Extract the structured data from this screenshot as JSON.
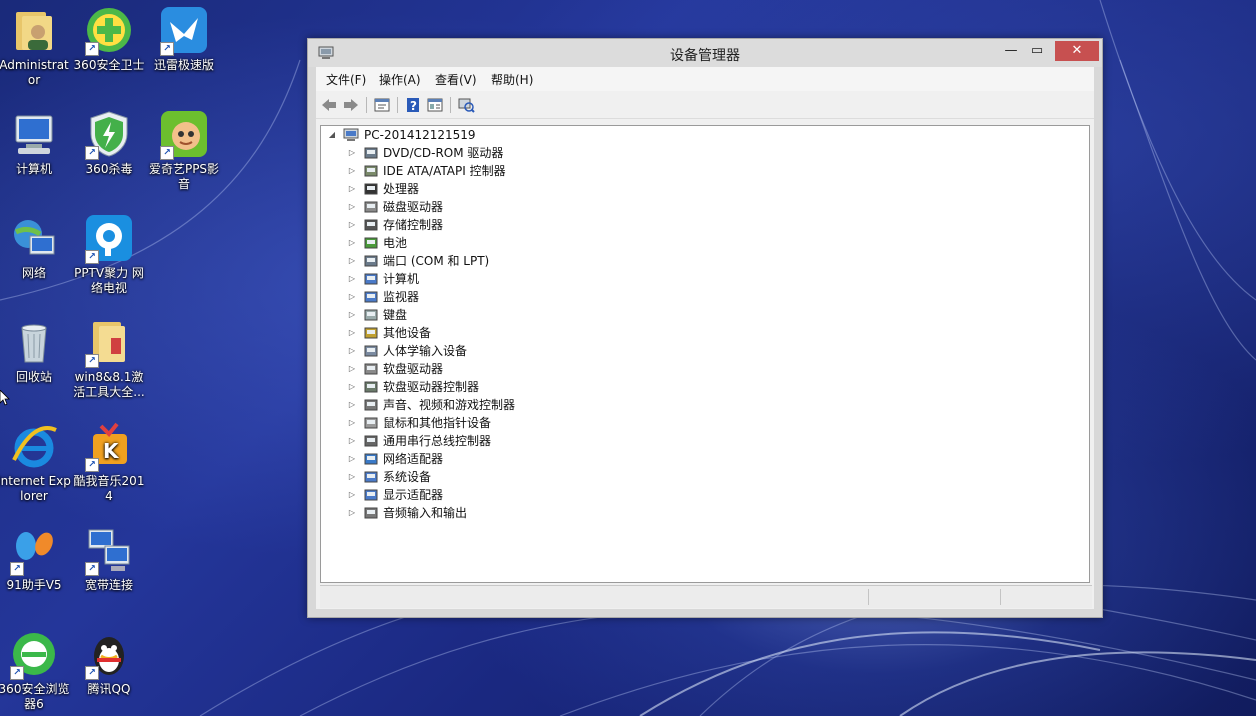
{
  "desktop": {
    "icons": [
      {
        "label": "Administrator",
        "icon": "user-folder-icon"
      },
      {
        "label": "360安全卫士",
        "icon": "shield-plus-icon"
      },
      {
        "label": "迅雷极速版",
        "icon": "bird-icon"
      },
      {
        "label": "计算机",
        "icon": "computer-icon"
      },
      {
        "label": "360杀毒",
        "icon": "shield-bolt-icon"
      },
      {
        "label": "爱奇艺PPS影音",
        "icon": "media-player-icon"
      },
      {
        "label": "网络",
        "icon": "network-icon"
      },
      {
        "label": "PPTV聚力 网络电视",
        "icon": "pptv-icon"
      },
      {
        "label": "回收站",
        "icon": "recycle-bin-icon"
      },
      {
        "label": "win8&8.1激活工具大全...",
        "icon": "folder-icon"
      },
      {
        "label": "Internet Explorer",
        "icon": "ie-icon"
      },
      {
        "label": "酷我音乐2014",
        "icon": "music-icon"
      },
      {
        "label": "91助手V5",
        "icon": "assistant-icon"
      },
      {
        "label": "宽带连接",
        "icon": "broadband-icon"
      },
      {
        "label": "360安全浏览器6",
        "icon": "browser-icon"
      },
      {
        "label": "腾讯QQ",
        "icon": "qq-icon"
      }
    ]
  },
  "window": {
    "title": "设备管理器",
    "menu": [
      "文件(F)",
      "操作(A)",
      "查看(V)",
      "帮助(H)"
    ],
    "toolbar": [
      "back-icon",
      "forward-icon",
      "properties-icon",
      "help-icon",
      "view-icon",
      "scan-icon"
    ],
    "tree": {
      "root": "PC-201412121519",
      "items": [
        {
          "label": "DVD/CD-ROM 驱动器",
          "icon": "dvd-drive-icon"
        },
        {
          "label": "IDE ATA/ATAPI 控制器",
          "icon": "ide-controller-icon"
        },
        {
          "label": "处理器",
          "icon": "processor-icon"
        },
        {
          "label": "磁盘驱动器",
          "icon": "disk-drive-icon"
        },
        {
          "label": "存储控制器",
          "icon": "storage-controller-icon"
        },
        {
          "label": "电池",
          "icon": "battery-icon"
        },
        {
          "label": "端口 (COM 和 LPT)",
          "icon": "port-icon"
        },
        {
          "label": "计算机",
          "icon": "computer-icon"
        },
        {
          "label": "监视器",
          "icon": "monitor-icon"
        },
        {
          "label": "键盘",
          "icon": "keyboard-icon"
        },
        {
          "label": "其他设备",
          "icon": "unknown-device-icon"
        },
        {
          "label": "人体学输入设备",
          "icon": "hid-icon"
        },
        {
          "label": "软盘驱动器",
          "icon": "floppy-drive-icon"
        },
        {
          "label": "软盘驱动器控制器",
          "icon": "floppy-controller-icon"
        },
        {
          "label": "声音、视频和游戏控制器",
          "icon": "sound-icon"
        },
        {
          "label": "鼠标和其他指针设备",
          "icon": "mouse-icon"
        },
        {
          "label": "通用串行总线控制器",
          "icon": "usb-icon"
        },
        {
          "label": "网络适配器",
          "icon": "network-adapter-icon"
        },
        {
          "label": "系统设备",
          "icon": "system-device-icon"
        },
        {
          "label": "显示适配器",
          "icon": "display-adapter-icon"
        },
        {
          "label": "音频输入和输出",
          "icon": "audio-io-icon"
        }
      ]
    }
  },
  "colors": {
    "close_button": "#c75050",
    "window_frame": "#dcdcdc",
    "desktop": "#1f3190"
  }
}
